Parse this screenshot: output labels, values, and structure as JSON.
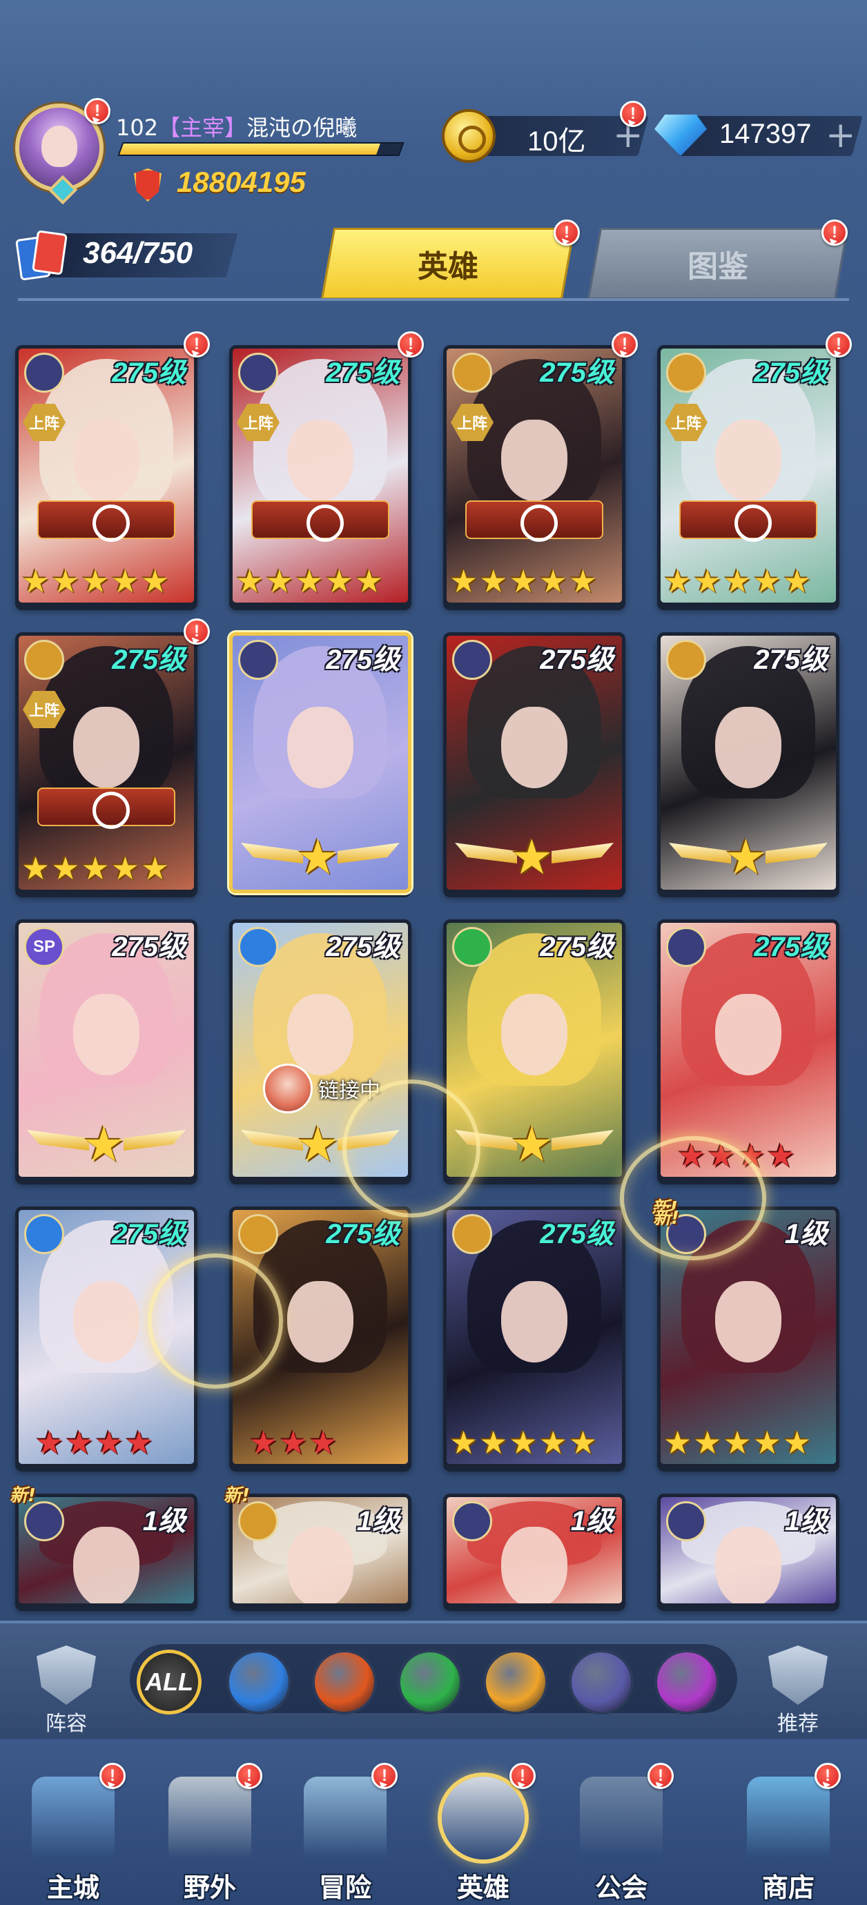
{
  "player": {
    "level": "102",
    "title": "【主宰】",
    "name": "混沌の倪曦",
    "exp_fraction": 0.92,
    "power": "18804195"
  },
  "resources": {
    "gold": "10亿",
    "diamonds": "147397",
    "plus": "+"
  },
  "hero_count": "364/750",
  "tabs": {
    "heroes": "英雄",
    "codex": "图鉴"
  },
  "alert_mark": "!",
  "on_team_label": "上阵",
  "new_label": "新!",
  "linking_label": "链接中",
  "heroes": [
    {
      "level": "275级",
      "faction": "dark",
      "on_team": true,
      "stars": 5,
      "star_type": "gold",
      "alert": true,
      "lvl_color": "cyan",
      "palette": [
        "#f2e3d7",
        "#c9332a"
      ]
    },
    {
      "level": "275级",
      "faction": "dark",
      "on_team": true,
      "stars": 5,
      "star_type": "gold",
      "alert": true,
      "lvl_color": "cyan",
      "palette": [
        "#e8e6ef",
        "#b51f25"
      ]
    },
    {
      "level": "275级",
      "faction": "light",
      "on_team": true,
      "stars": 5,
      "star_type": "gold",
      "alert": true,
      "lvl_color": "cyan",
      "palette": [
        "#2b1f24",
        "#c38a6d"
      ]
    },
    {
      "level": "275级",
      "faction": "light",
      "on_team": true,
      "stars": 5,
      "star_type": "gold",
      "alert": true,
      "lvl_color": "cyan",
      "palette": [
        "#dde6ea",
        "#7ab7a0"
      ]
    },
    {
      "level": "275级",
      "faction": "light",
      "on_team": true,
      "stars": 5,
      "star_type": "gold",
      "alert": true,
      "lvl_color": "cyan",
      "palette": [
        "#1d1820",
        "#c0694c"
      ]
    },
    {
      "level": "275级",
      "faction": "dark",
      "on_team": false,
      "stars": 1,
      "star_type": "winged",
      "alert": false,
      "lvl_color": "white",
      "palette": [
        "#b9b1e8",
        "#7f8ed9"
      ],
      "selected": true
    },
    {
      "level": "275级",
      "faction": "dark",
      "on_team": false,
      "stars": 1,
      "star_type": "winged",
      "alert": false,
      "lvl_color": "white",
      "palette": [
        "#2a2a2d",
        "#b8241f"
      ]
    },
    {
      "level": "275级",
      "faction": "light",
      "on_team": false,
      "stars": 1,
      "star_type": "winged",
      "alert": false,
      "lvl_color": "white",
      "palette": [
        "#1b1a20",
        "#e6dcd4"
      ]
    },
    {
      "level": "275级",
      "faction": "sp",
      "on_team": false,
      "stars": 1,
      "star_type": "winged",
      "alert": false,
      "lvl_color": "white",
      "palette": [
        "#f2b6c4",
        "#e7d3c2"
      ]
    },
    {
      "level": "275级",
      "faction": "water",
      "on_team": false,
      "stars": 1,
      "star_type": "winged",
      "alert": false,
      "lvl_color": "white",
      "palette": [
        "#f4d27a",
        "#a7c7ee"
      ],
      "linking": true
    },
    {
      "level": "275级",
      "faction": "wind",
      "on_team": false,
      "stars": 1,
      "star_type": "winged",
      "alert": false,
      "lvl_color": "white",
      "palette": [
        "#f1d159",
        "#5a7a4e"
      ]
    },
    {
      "level": "275级",
      "faction": "dark",
      "on_team": false,
      "stars": 4,
      "star_type": "red",
      "alert": false,
      "lvl_color": "cyan",
      "palette": [
        "#d84a4a",
        "#f3c9bd"
      ]
    },
    {
      "level": "275级",
      "faction": "water",
      "on_team": false,
      "stars": 4,
      "star_type": "red",
      "alert": false,
      "lvl_color": "cyan",
      "palette": [
        "#e9e3ee",
        "#7d9dc9"
      ]
    },
    {
      "level": "275级",
      "faction": "light",
      "on_team": false,
      "stars": 3,
      "star_type": "red",
      "alert": false,
      "lvl_color": "cyan",
      "palette": [
        "#2a1b17",
        "#e2a14a"
      ]
    },
    {
      "level": "275级",
      "faction": "light",
      "on_team": false,
      "stars": 5,
      "star_type": "gold",
      "alert": false,
      "lvl_color": "cyan",
      "palette": [
        "#16162a",
        "#5a5f9e"
      ]
    },
    {
      "level": "1级",
      "faction": "dark",
      "on_team": false,
      "stars": 5,
      "star_type": "gold",
      "alert": false,
      "lvl_color": "white",
      "palette": [
        "#5b1e2e",
        "#3b7a8a"
      ],
      "new": true
    },
    {
      "level": "1级",
      "faction": "dark",
      "on_team": false,
      "stars": 0,
      "star_type": "gold",
      "alert": false,
      "lvl_color": "white",
      "palette": [
        "#5b1e2e",
        "#3b7a8a"
      ],
      "new": true
    },
    {
      "level": "1级",
      "faction": "light",
      "on_team": false,
      "stars": 0,
      "star_type": "gold",
      "alert": false,
      "lvl_color": "white",
      "palette": [
        "#e9e2d6",
        "#a77f5a"
      ],
      "new": true
    },
    {
      "level": "1级",
      "faction": "dark",
      "on_team": false,
      "stars": 0,
      "star_type": "gold",
      "alert": false,
      "lvl_color": "white",
      "palette": [
        "#d64541",
        "#f0cdbf"
      ]
    },
    {
      "level": "1级",
      "faction": "dark",
      "on_team": false,
      "stars": 0,
      "star_type": "gold",
      "alert": false,
      "lvl_color": "white",
      "palette": [
        "#e2e2ee",
        "#5b4aa0"
      ]
    }
  ],
  "filter": {
    "left_label": "阵容",
    "right_label": "推荐",
    "all_label": "ALL",
    "factions": [
      {
        "name": "water",
        "color": "#2f7fe0"
      },
      {
        "name": "fire",
        "color": "#e0571f"
      },
      {
        "name": "wind",
        "color": "#2fb24a"
      },
      {
        "name": "light",
        "color": "#f0a42a"
      },
      {
        "name": "dark",
        "color": "#5a5aa8"
      },
      {
        "name": "chaos",
        "color": "#b03ac9"
      }
    ]
  },
  "nav": [
    {
      "label": "主城",
      "alert": true,
      "icon": "castle-icon"
    },
    {
      "label": "野外",
      "alert": true,
      "icon": "portal-icon"
    },
    {
      "label": "冒险",
      "alert": true,
      "icon": "trident-icon"
    },
    {
      "label": "英雄",
      "alert": true,
      "icon": "helmet-icon",
      "active": true
    },
    {
      "label": "公会",
      "alert": true,
      "icon": "guild-banner-icon"
    },
    {
      "label": "商店",
      "alert": true,
      "icon": "shop-icon"
    }
  ],
  "colors": {
    "dark": "#3a3e7a",
    "light": "#d79a2c",
    "water": "#2f7fe0",
    "wind": "#2fb24a",
    "sp": "#6a4fcf"
  }
}
